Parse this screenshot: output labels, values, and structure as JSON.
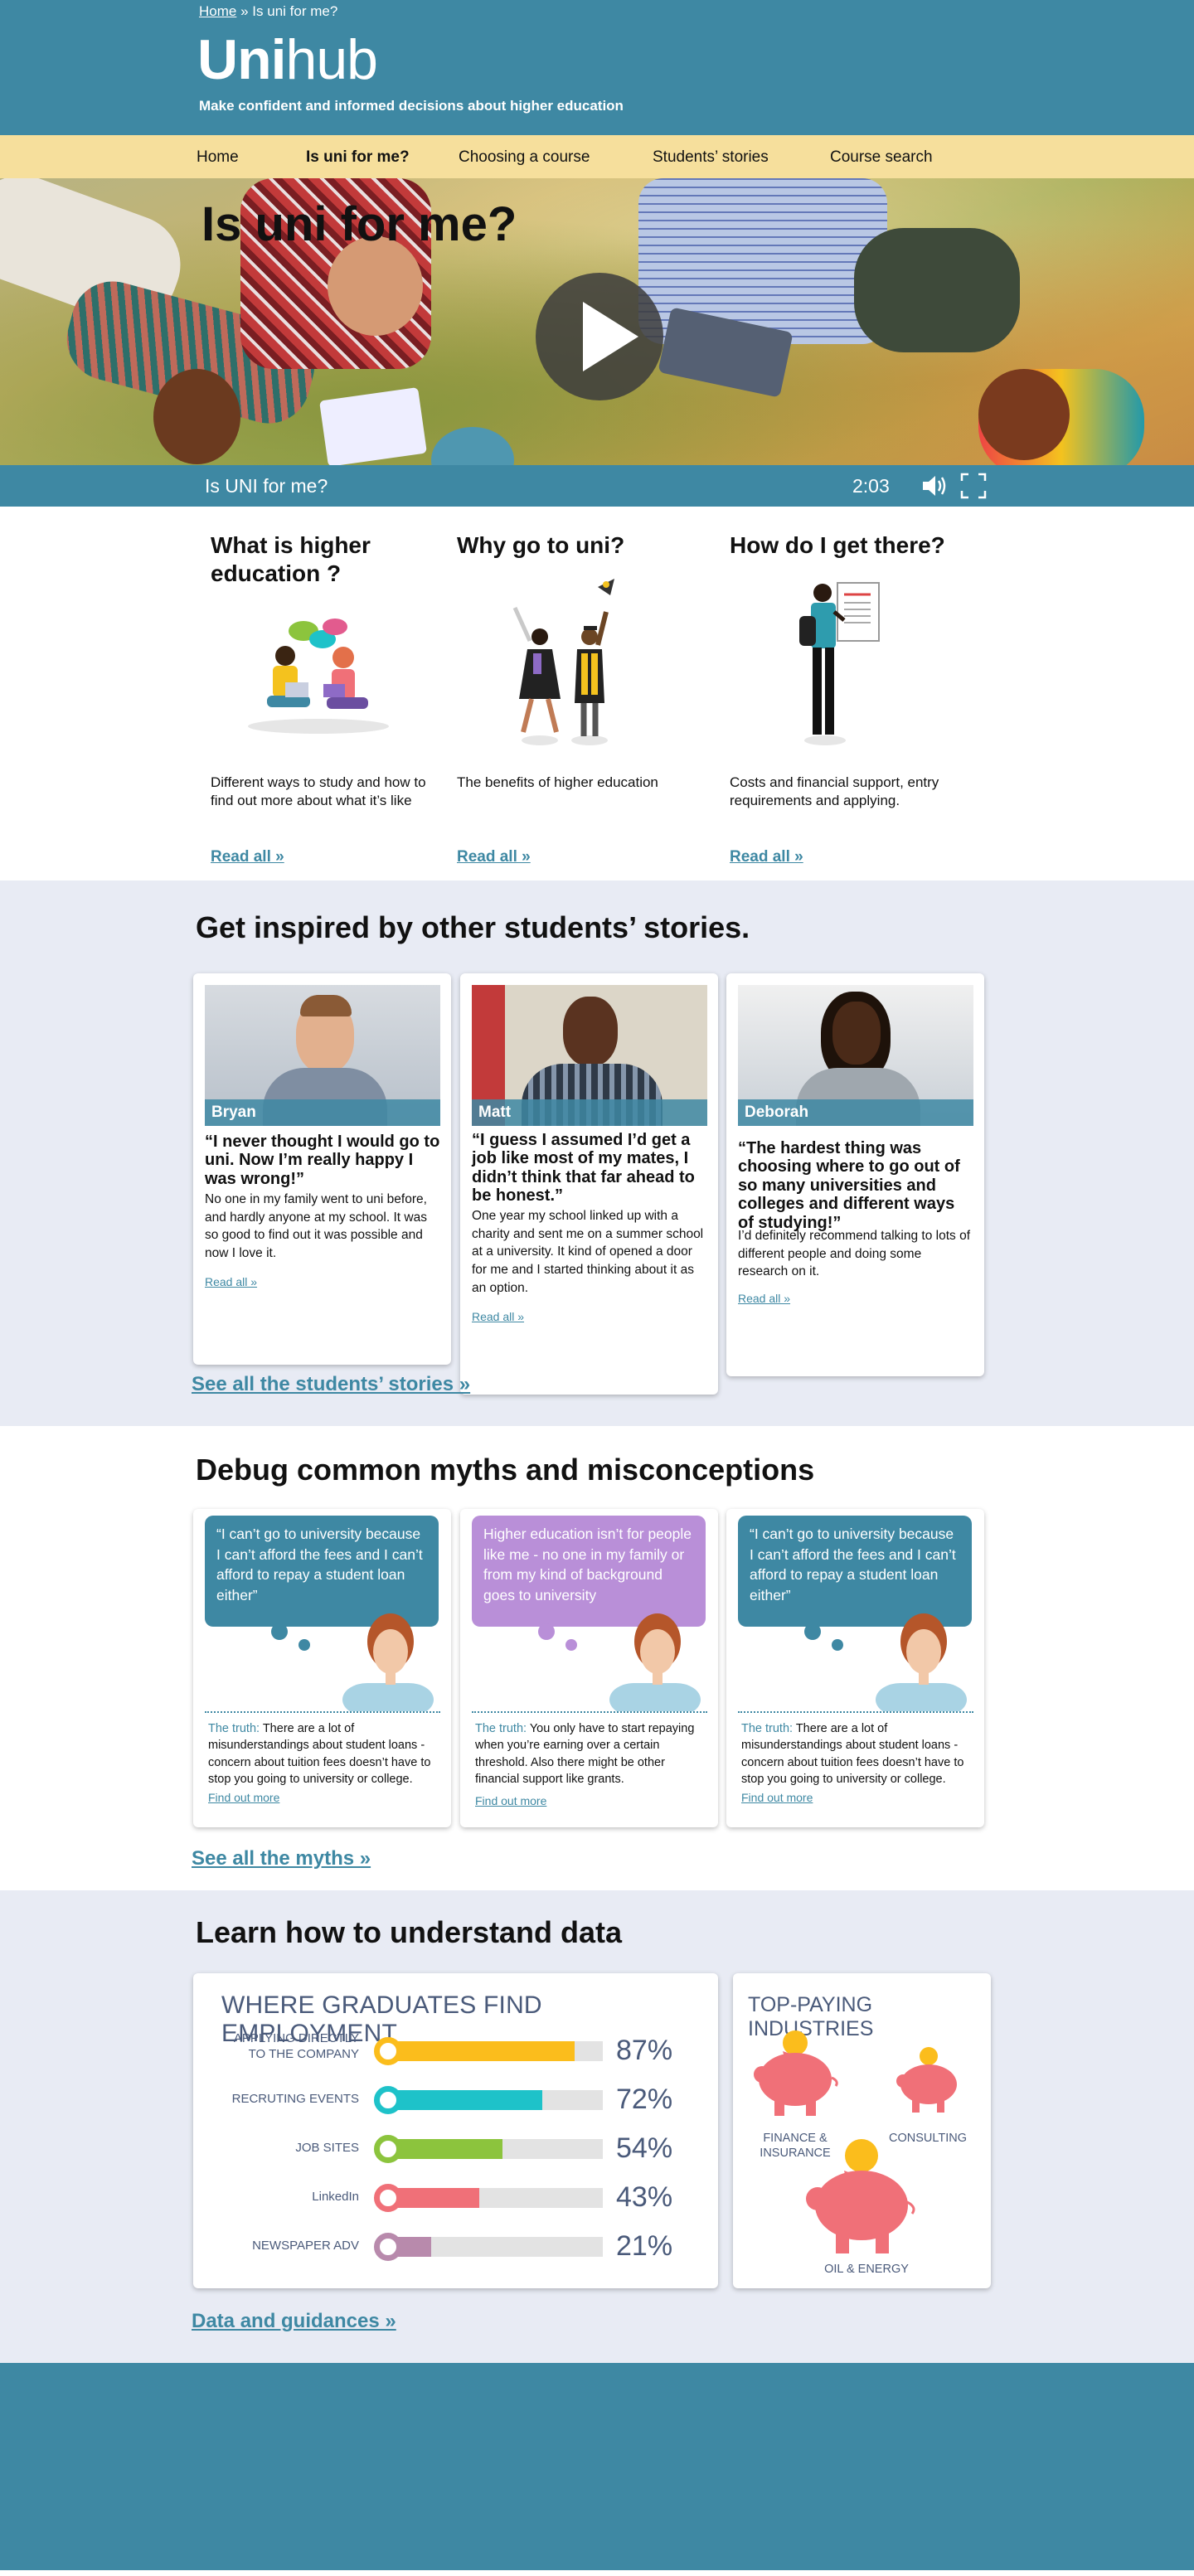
{
  "breadcrumb": {
    "home": "Home",
    "sep": "»",
    "current": "Is uni for me?"
  },
  "brand": {
    "logo_bold": "Uni",
    "logo_light": "hub",
    "tagline": "Make confident and informed decisions about higher education"
  },
  "nav": {
    "items": [
      {
        "label": "Home",
        "active": false
      },
      {
        "label": "Is uni for me?",
        "active": true
      },
      {
        "label": "Choosing a course",
        "active": false
      },
      {
        "label": "Students’ stories",
        "active": false
      },
      {
        "label": "Course search",
        "active": false
      }
    ]
  },
  "hero": {
    "title": "Is uni for me?",
    "video_title": "Is UNI for me?",
    "duration": "2:03"
  },
  "intro": {
    "columns": [
      {
        "title": "What is higher education ?",
        "text": "Different ways to study and how to find out more about what it’s like",
        "link": "Read all »"
      },
      {
        "title": "Why go to uni?",
        "text": "The benefits of higher education",
        "link": "Read all »"
      },
      {
        "title": "How do I get there?",
        "text": "Costs and financial support, entry requirements and applying.",
        "link": "Read all »"
      }
    ]
  },
  "stories": {
    "title": "Get inspired by other students’ stories.",
    "cards": [
      {
        "name": "Bryan",
        "quote": "“I never thought I would go to uni. Now I’m really happy I was wrong!”",
        "body": "No one in my family went to uni before, and hardly anyone at my school. It was so good to find out it was possible and now I love it.",
        "link": "Read all »"
      },
      {
        "name": "Matt",
        "quote": "“I guess I assumed I’d get a job like most of my mates, I didn’t think that far ahead to be honest.”",
        "body": "One year my school linked up with a charity and sent me on a summer school at a university. It kind of opened a door for me and I started thinking about it as an option.",
        "link": "Read all »"
      },
      {
        "name": "Deborah",
        "quote": "“The hardest thing was choosing where to go out of so many universities and colleges and different ways of studying!”",
        "body": "I’d definitely recommend talking to lots of different people and doing some research on it.",
        "link": "Read all »"
      }
    ],
    "see_all": "See all the students’ stories »"
  },
  "myths": {
    "title": "Debug common myths and misconceptions",
    "cards": [
      {
        "myth": "“I can’t go to university because I can’t afford the fees and I can’t afford to repay a student loan either”",
        "truth_label": "The truth:",
        "truth": " There are a lot of misunderstandings about student loans - concern about tuition fees doesn’t have to stop you going to university or college.",
        "link": "Find out more",
        "color": "#3e88a3"
      },
      {
        "myth": "Higher education isn’t for people like me - no one in my family or from my kind of background goes to university",
        "truth_label": "The truth:",
        "truth": "  You only have to start repaying when you’re earning over a certain threshold. Also there might be other financial support like grants.",
        "link": "Find out more",
        "color": "#b98fd8"
      },
      {
        "myth": "“I can’t go to university because I can’t afford the fees and I can’t afford to repay a student loan either”",
        "truth_label": "The truth:",
        "truth": " There are a lot of misunderstandings about student loans - concern about tuition fees doesn’t have to stop you going to university or college.",
        "link": "Find out more",
        "color": "#3e88a3"
      }
    ],
    "see_all": "See all the myths »"
  },
  "data": {
    "title": "Learn how to understand data",
    "employment": {
      "title": "WHERE GRADUATES FIND EMPLOYMENT",
      "bars": [
        {
          "label": "APPLYING DIRECTLY TO THE COMPANY",
          "value": 87,
          "pct": "87%",
          "color": "#fbbd1c"
        },
        {
          "label": "RECRUTING EVENTS",
          "value": 72,
          "pct": "72%",
          "color": "#1ec2c9"
        },
        {
          "label": "JOB SITES",
          "value": 54,
          "pct": "54%",
          "color": "#8cc43d"
        },
        {
          "label": "LinkedIn",
          "value": 43,
          "pct": "43%",
          "color": "#f07078"
        },
        {
          "label": "NEWSPAPER ADV",
          "value": 21,
          "pct": "21%",
          "color": "#b88aac"
        }
      ]
    },
    "industries": {
      "title": "TOP-PAYING INDUSTRIES",
      "items": [
        {
          "label": "FINANCE & INSURANCE"
        },
        {
          "label": "CONSULTING"
        },
        {
          "label": "OIL & ENERGY"
        }
      ]
    },
    "link": "Data and guidances »"
  }
}
